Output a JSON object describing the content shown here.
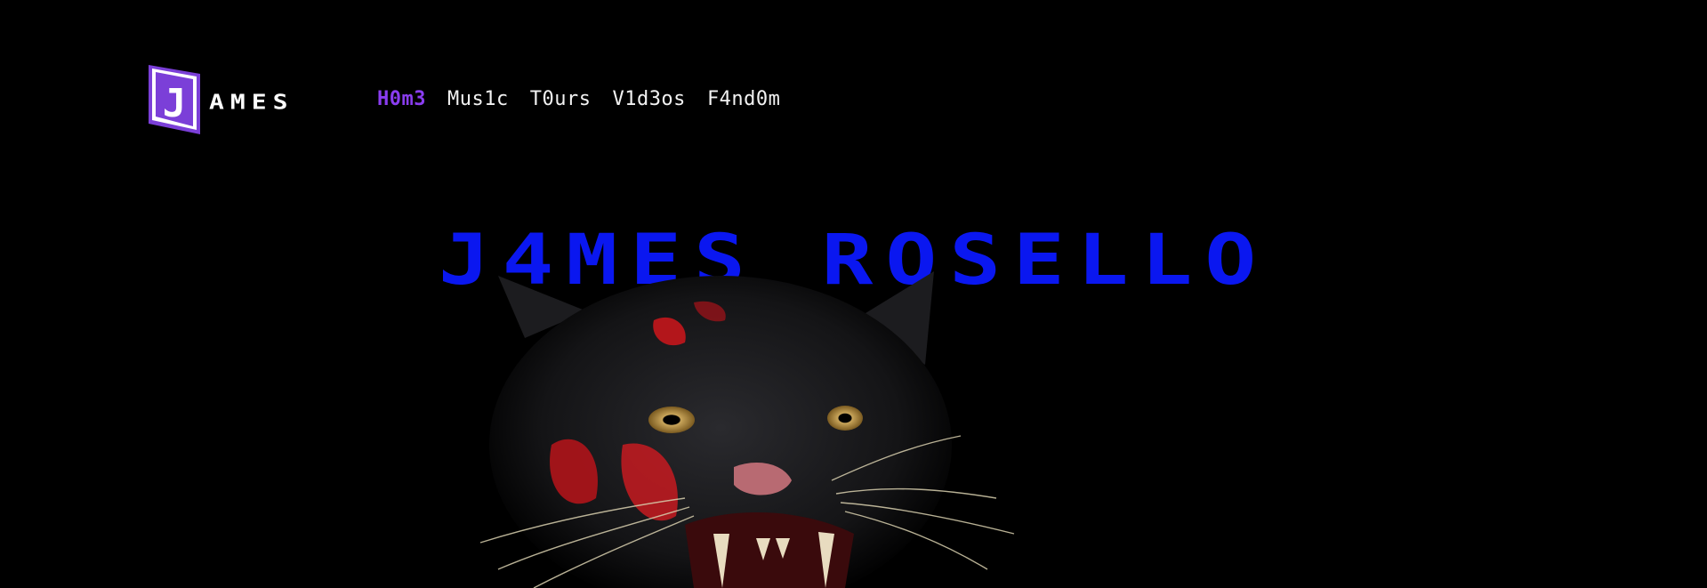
{
  "logo": {
    "letter": "J",
    "text": "AMES"
  },
  "nav": {
    "items": [
      {
        "label": "H0m3",
        "active": true
      },
      {
        "label": "Mus1c",
        "active": false
      },
      {
        "label": "T0urs",
        "active": false
      },
      {
        "label": "V1d3os",
        "active": false
      },
      {
        "label": "F4nd0m",
        "active": false
      }
    ]
  },
  "hero": {
    "title": "J4MES ROSELLO",
    "image": "panther-face-image"
  },
  "colors": {
    "background": "#000000",
    "title": "#0a17f0",
    "nav_active": "#8a3df0",
    "nav_text": "#f2f2f2",
    "logo_badge": "#7b3fd8"
  }
}
